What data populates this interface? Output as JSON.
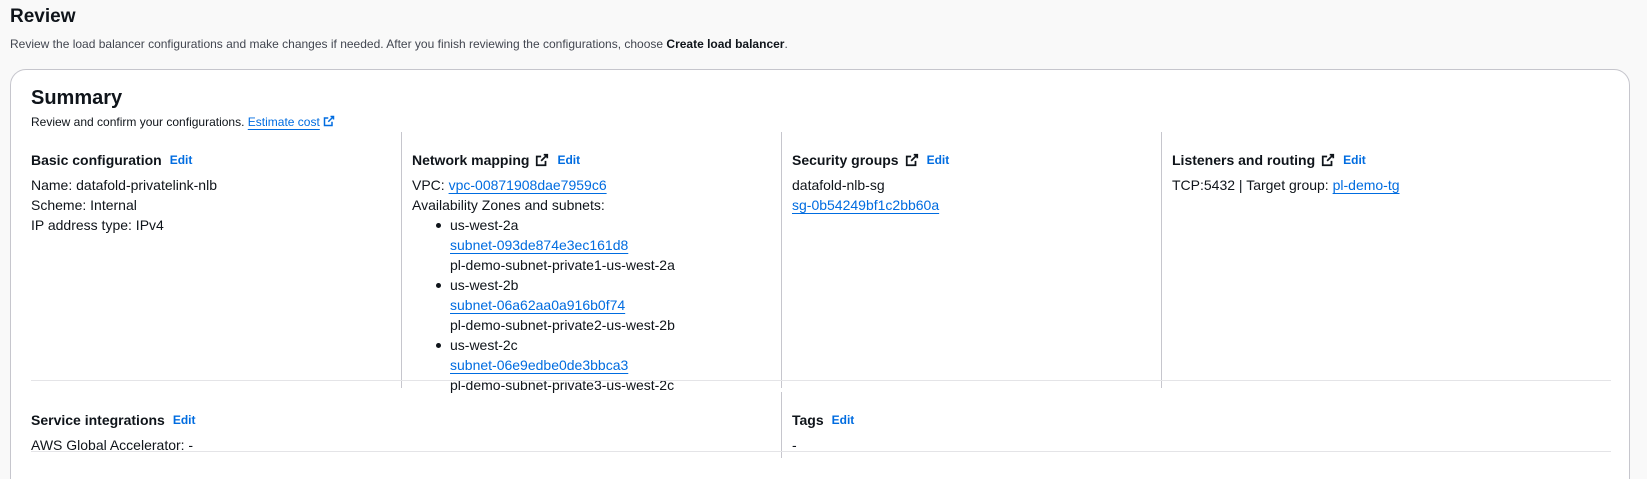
{
  "review": {
    "title": "Review",
    "description_prefix": "Review the load balancer configurations and make changes if needed. After you finish reviewing the configurations, choose ",
    "description_bold": "Create load balancer",
    "description_suffix": "."
  },
  "summary": {
    "title": "Summary",
    "description": "Review and confirm your configurations.",
    "estimate_cost_link": "Estimate cost"
  },
  "edit_label": "Edit",
  "basic_configuration": {
    "heading": "Basic configuration",
    "name": "Name: datafold-privatelink-nlb",
    "scheme": "Scheme: Internal",
    "ip_type": "IP address type: IPv4"
  },
  "network_mapping": {
    "heading": "Network mapping",
    "vpc_label": "VPC:",
    "vpc_link": "vpc-00871908dae7959c6",
    "az_label": "Availability Zones and subnets:",
    "zones": [
      {
        "zone": "us-west-2a",
        "subnet": "subnet-093de874e3ec161d8",
        "subnet_name": "pl-demo-subnet-private1-us-west-2a"
      },
      {
        "zone": "us-west-2b",
        "subnet": "subnet-06a62aa0a916b0f74",
        "subnet_name": "pl-demo-subnet-private2-us-west-2b"
      },
      {
        "zone": "us-west-2c",
        "subnet": "subnet-06e9edbe0de3bbca3",
        "subnet_name": "pl-demo-subnet-private3-us-west-2c"
      }
    ]
  },
  "security_groups": {
    "heading": "Security groups",
    "group_name": "datafold-nlb-sg",
    "group_id": "sg-0b54249bf1c2bb60a"
  },
  "listeners": {
    "heading": "Listeners and routing",
    "listener": "TCP:5432 | Target group: ",
    "target_group": "pl-demo-tg"
  },
  "service_integrations": {
    "heading": "Service integrations",
    "global_accelerator": "AWS Global Accelerator: -"
  },
  "tags": {
    "heading": "Tags",
    "value": "-"
  },
  "colors": {
    "link": "#006ce0",
    "text": "#0f141a",
    "border": "#c6c6cd"
  }
}
